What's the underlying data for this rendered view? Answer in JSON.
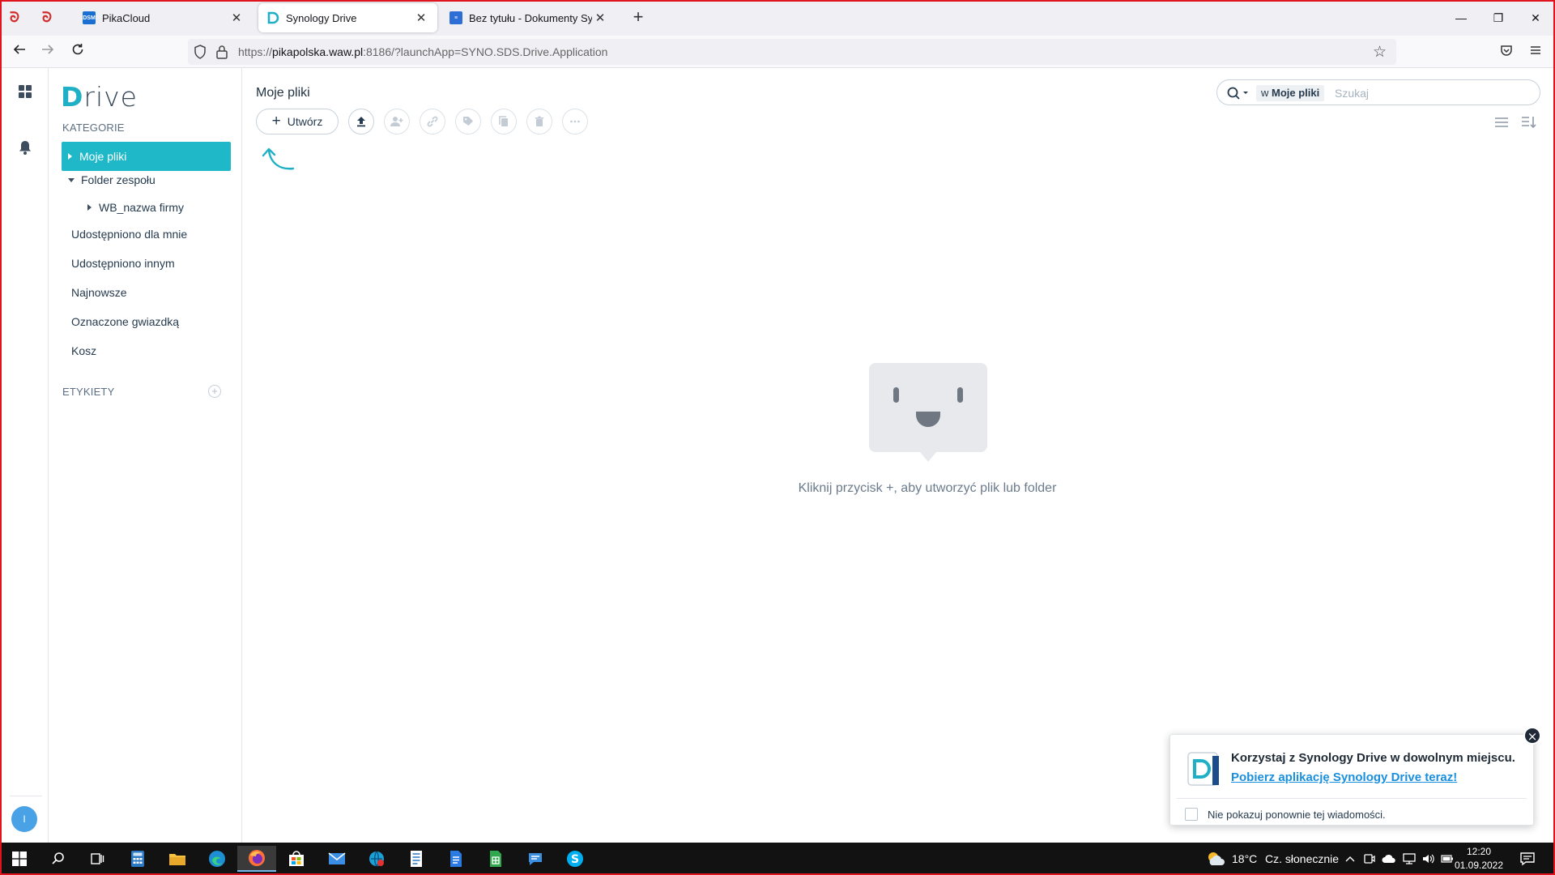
{
  "browser": {
    "tabs": [
      {
        "title": "PikaCloud",
        "favicon": "DSM",
        "active": false
      },
      {
        "title": "Synology Drive",
        "favicon": "drive-logo",
        "active": true
      },
      {
        "title": "Bez tytułu - Dokumenty Synolo",
        "favicon": "docs-logo",
        "active": false
      }
    ],
    "url": {
      "prefix": "https://",
      "host": "pikapolska.waw.pl",
      "rest": ":8186/?launchApp=SYNO.SDS.Drive.Application"
    }
  },
  "rail": {
    "avatar_letter": "I"
  },
  "sidebar": {
    "logo": {
      "first_letter": "D",
      "rest": "rive"
    },
    "categories_title": "KATEGORIE",
    "items": [
      {
        "label": "Moje pliki",
        "active": true
      },
      {
        "label": "Folder zespołu",
        "expanded": true
      },
      {
        "label": "WB_nazwa firmy"
      },
      {
        "label": "Udostępniono dla mnie"
      },
      {
        "label": "Udostępniono innym"
      },
      {
        "label": "Najnowsze"
      },
      {
        "label": "Oznaczone gwiazdką"
      },
      {
        "label": "Kosz"
      }
    ],
    "labels_title": "ETYKIETY"
  },
  "main": {
    "title": "Moje pliki",
    "create_label": "Utwórz",
    "search": {
      "scope_prefix": "w",
      "scope_name": "Moje pliki",
      "placeholder": "Szukaj"
    },
    "empty_text": "Kliknij przycisk +, aby utworzyć plik lub folder"
  },
  "notification": {
    "title": "Korzystaj z Synology Drive w dowolnym miejscu.",
    "link": "Pobierz aplikację Synology Drive teraz!",
    "checkbox_label": "Nie pokazuj ponownie tej wiadomości."
  },
  "taskbar": {
    "weather_temp": "18°C",
    "weather_desc": "Cz. słonecznie",
    "time": "12:20",
    "date": "01.09.2022"
  },
  "colors": {
    "accent": "#1fb8c9",
    "link": "#1a8fde",
    "frame": "#e0141e"
  }
}
